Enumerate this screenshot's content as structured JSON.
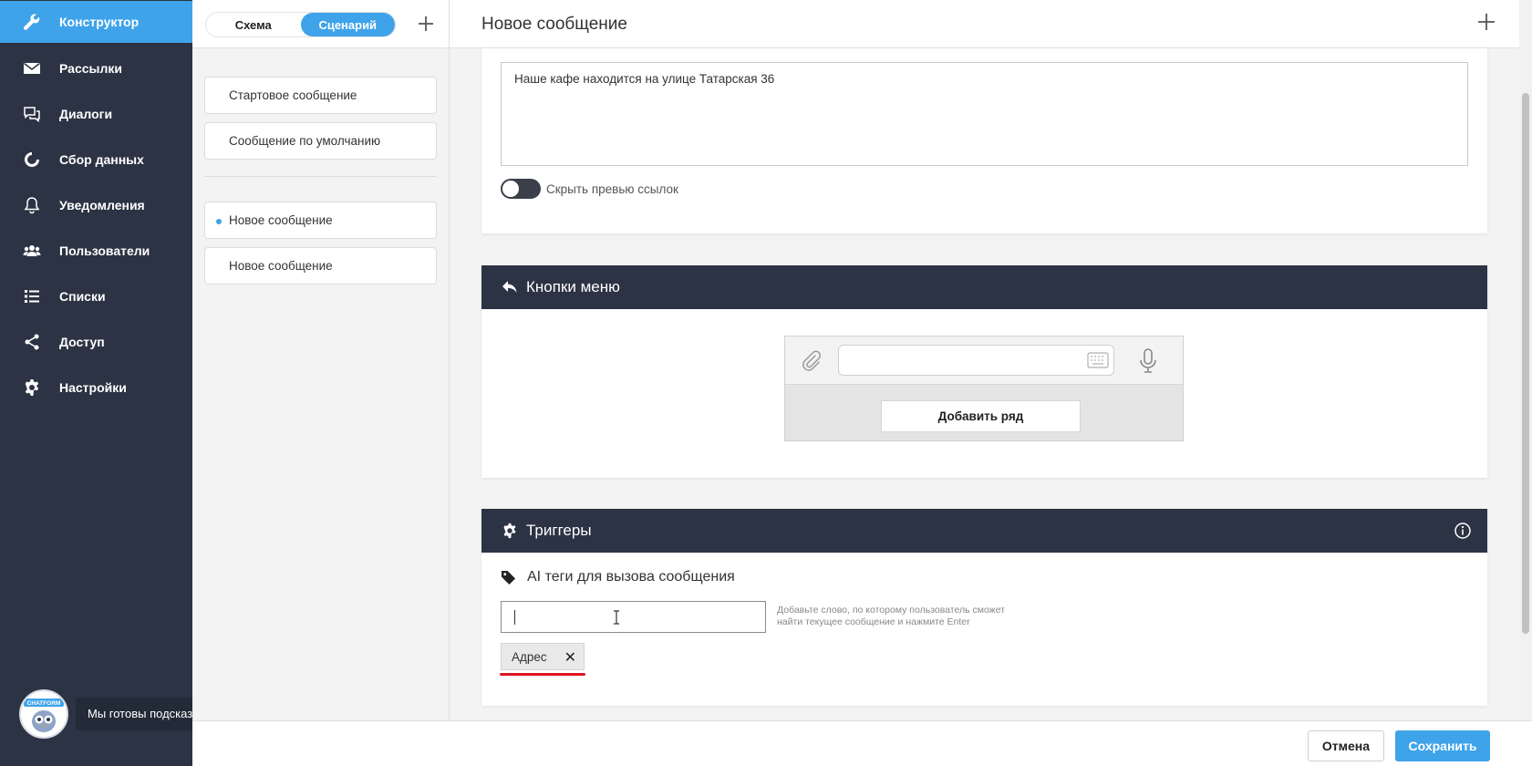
{
  "sidebar": {
    "items": [
      {
        "label": "Конструктор",
        "icon": "wrench-icon",
        "active": true
      },
      {
        "label": "Рассылки",
        "icon": "envelope-icon"
      },
      {
        "label": "Диалоги",
        "icon": "chat-bubbles-icon"
      },
      {
        "label": "Сбор данных",
        "icon": "circular-arrow-icon"
      },
      {
        "label": "Уведомления",
        "icon": "bell-icon"
      },
      {
        "label": "Пользователи",
        "icon": "users-icon"
      },
      {
        "label": "Списки",
        "icon": "list-icon"
      },
      {
        "label": "Доступ",
        "icon": "share-icon"
      },
      {
        "label": "Настройки",
        "icon": "gear-icon"
      }
    ],
    "assistant": {
      "tooltip": "Мы готовы подсказать!",
      "logo_text": "CHATFORM"
    }
  },
  "middle": {
    "tabs": [
      {
        "label": "Схема"
      },
      {
        "label": "Сценарий",
        "active": true
      }
    ],
    "messages": [
      {
        "label": "Стартовое сообщение"
      },
      {
        "label": "Сообщение по умолчанию"
      },
      {
        "label": "Новое сообщение",
        "selected": true
      },
      {
        "label": "Новое сообщение"
      }
    ]
  },
  "main": {
    "title": "Новое сообщение",
    "message_text": "Наше кафе находится на улице Татарская 36",
    "hide_link_preview": {
      "label": "Скрыть превью ссылок",
      "on": false
    },
    "menu_buttons": {
      "title": "Кнопки меню",
      "add_row": "Добавить ряд"
    },
    "triggers": {
      "title": "Триггеры",
      "ai_tags_title": "AI теги для вызова сообщения",
      "input_value": "",
      "hint": "Добавьте слово, по которому пользователь сможет найти текущее сообщение и нажмите Enter",
      "tags": [
        {
          "label": "Адрес"
        }
      ]
    }
  },
  "footer": {
    "cancel": "Отмена",
    "save": "Сохранить"
  },
  "colors": {
    "accent": "#3fa3ea",
    "sidebar_bg": "#2c3344",
    "underline": "#e1141f"
  }
}
